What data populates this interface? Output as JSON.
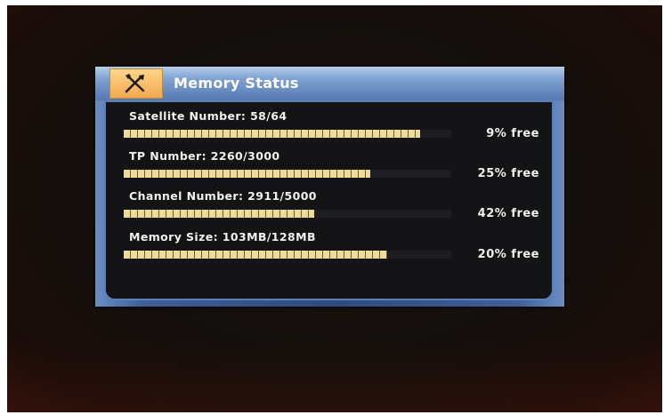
{
  "window": {
    "title": "Memory Status",
    "icon": "tools-icon"
  },
  "rows": [
    {
      "label": "Satellite Number: 58/64",
      "free_text": "9% free",
      "used_fraction": 0.906
    },
    {
      "label": "TP Number: 2260/3000",
      "free_text": "25% free",
      "used_fraction": 0.753
    },
    {
      "label": "Channel Number: 2911/5000",
      "free_text": "42% free",
      "used_fraction": 0.582
    },
    {
      "label": "Memory Size: 103MB/128MB",
      "free_text": "20% free",
      "used_fraction": 0.805
    }
  ],
  "colors": {
    "title_bar": "#7fa2d2",
    "icon_box": "#f2a94e",
    "bar_fill": "#e0cd82",
    "panel_bg": "#141416",
    "border": "#5f7fb4"
  }
}
